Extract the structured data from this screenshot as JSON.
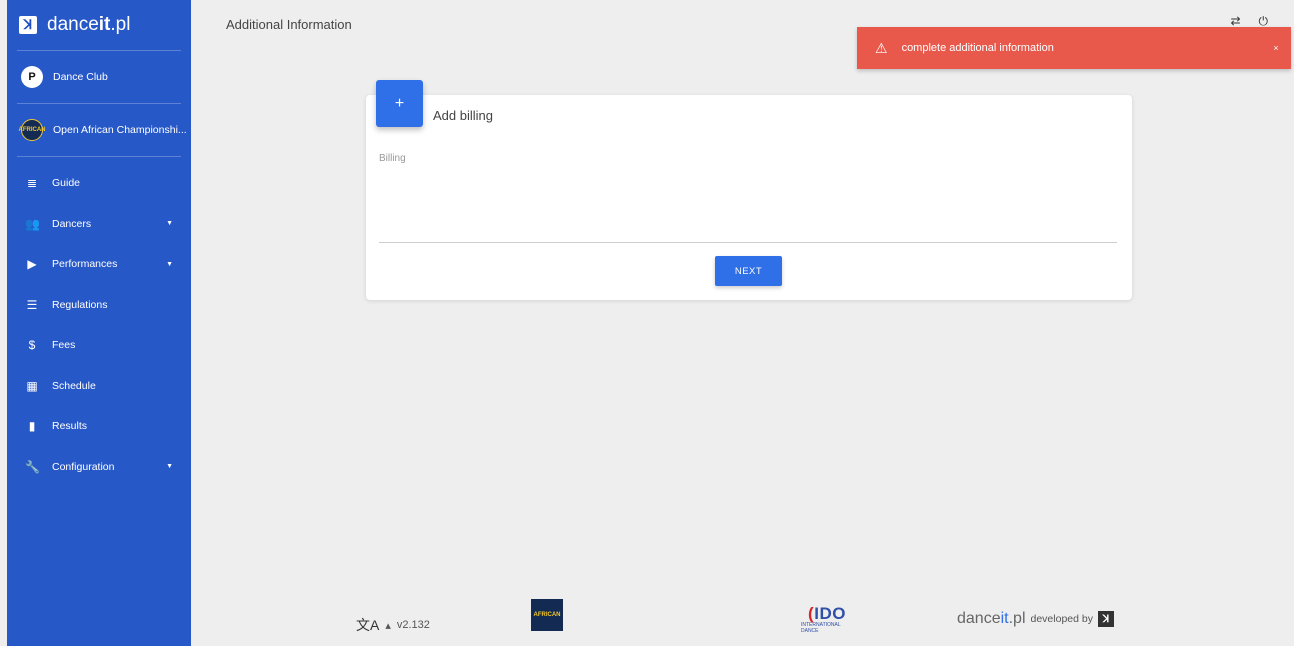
{
  "sidebar": {
    "brand": {
      "logo_glyph": "ꓘ",
      "name_prefix": "dance",
      "name_bold": "it",
      "name_suffix": ".pl"
    },
    "club": {
      "avatar_text": "P",
      "label": "Dance Club"
    },
    "event": {
      "avatar_text": "AFRICAN",
      "label": "Open African Championshi..."
    },
    "items": [
      {
        "icon": "guide-icon",
        "glyph": "≣",
        "label": "Guide",
        "has_caret": false
      },
      {
        "icon": "dancers-icon",
        "glyph": "👥",
        "label": "Dancers",
        "has_caret": true
      },
      {
        "icon": "performances-icon",
        "glyph": "▶",
        "label": "Performances",
        "has_caret": true
      },
      {
        "icon": "regulations-icon",
        "glyph": "☰",
        "label": "Regulations",
        "has_caret": false
      },
      {
        "icon": "fees-icon",
        "glyph": "$",
        "label": "Fees",
        "has_caret": false
      },
      {
        "icon": "schedule-icon",
        "glyph": "▦",
        "label": "Schedule",
        "has_caret": false
      },
      {
        "icon": "results-icon",
        "glyph": "▮",
        "label": "Results",
        "has_caret": false
      },
      {
        "icon": "configuration-icon",
        "glyph": "🔧",
        "label": "Configuration",
        "has_caret": true
      }
    ],
    "caret_glyph": "▼"
  },
  "header": {
    "title": "Additional Information",
    "icon_1": "⇄",
    "icon_2": "⏻"
  },
  "toast": {
    "icon": "⚠",
    "message": "complete additional information",
    "close": "×",
    "color": "#e8594b"
  },
  "card": {
    "add_button": "+",
    "title": "Add billing",
    "field_label": "Billing",
    "field_value": "",
    "next_button": "NEXT"
  },
  "footer": {
    "lang_icon": "文A",
    "lang_caret": "▴",
    "version": "v2.132",
    "champ_logo_text": "AFRICAN",
    "ido_main_prefix": "(",
    "ido_main": "IDO",
    "ido_sub": "INTERNATIONAL DANCE",
    "brand_prefix": "dance",
    "brand_bold": "it",
    "brand_suffix": ".pl",
    "developed_by": "developed by",
    "logo_glyph": "ꓘ"
  },
  "colors": {
    "sidebar": "#2758c7",
    "primary": "#2f6fe8",
    "background": "#eeeeee"
  }
}
